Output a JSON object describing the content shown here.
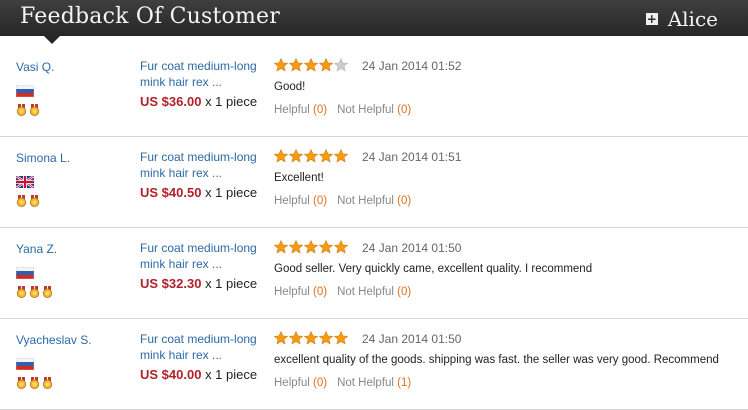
{
  "header": {
    "title": "Feedback Of Customer",
    "user_name": "Alice",
    "plus_symbol": "+"
  },
  "labels": {
    "helpful": "Helpful",
    "not_helpful": "Not Helpful"
  },
  "colors": {
    "star_filled": "#f39c12",
    "star_empty": "#cccccc",
    "price": "#b3202a",
    "link": "#2c6aa6"
  },
  "reviews": [
    {
      "buyer": "Vasi Q.",
      "country_flag": "russia-flag-icon",
      "medals": 2,
      "product": "Fur coat medium-long mink hair rex ...",
      "price": "US $36.00",
      "quantity": "x 1 piece",
      "rating": 4,
      "date": "24 Jan 2014 01:52",
      "text": "Good!",
      "helpful_count": "(0)",
      "not_helpful_count": "(0)"
    },
    {
      "buyer": "Simona L.",
      "country_flag": "uk-flag-icon",
      "medals": 2,
      "product": "Fur coat medium-long mink hair rex ...",
      "price": "US $40.50",
      "quantity": "x 1 piece",
      "rating": 5,
      "date": "24 Jan 2014 01:51",
      "text": "Excellent!",
      "helpful_count": "(0)",
      "not_helpful_count": "(0)"
    },
    {
      "buyer": "Yana Z.",
      "country_flag": "russia-flag-icon",
      "medals": 3,
      "product": "Fur coat medium-long mink hair rex ...",
      "price": "US $32.30",
      "quantity": "x 1 piece",
      "rating": 5,
      "date": "24 Jan 2014 01:50",
      "text": "Good seller. Very quickly came, excellent quality. I recommend",
      "helpful_count": "(0)",
      "not_helpful_count": "(0)"
    },
    {
      "buyer": "Vyacheslav S.",
      "country_flag": "russia-flag-icon",
      "medals": 3,
      "product": "Fur coat medium-long mink hair rex ...",
      "price": "US $40.00",
      "quantity": "x 1 piece",
      "rating": 5,
      "date": "24 Jan 2014 01:50",
      "text": "excellent quality of the goods. shipping was fast. the seller was very good. Recommend",
      "helpful_count": "(0)",
      "not_helpful_count": "(1)"
    }
  ]
}
